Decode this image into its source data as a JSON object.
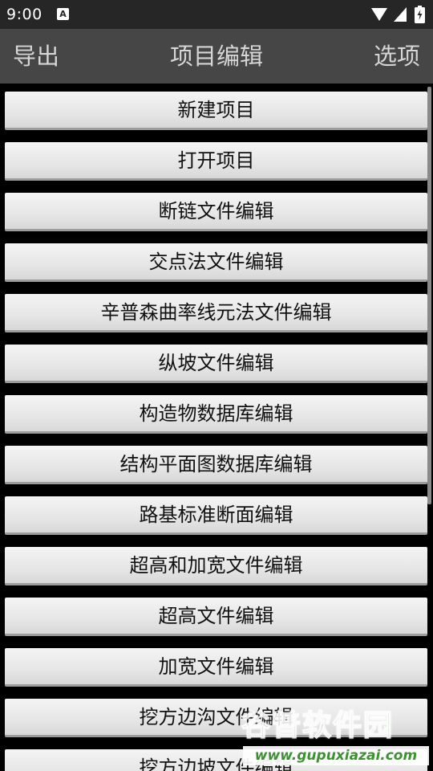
{
  "status_bar": {
    "time": "9:00",
    "badge": "A"
  },
  "app_bar": {
    "export_label": "导出",
    "title": "项目编辑",
    "options_label": "选项"
  },
  "menu": {
    "items": [
      "新建项目",
      "打开项目",
      "断链文件编辑",
      "交点法文件编辑",
      "辛普森曲率线元法文件编辑",
      "纵坡文件编辑",
      "构造物数据库编辑",
      "结构平面图数据库编辑",
      "路基标准断面编辑",
      "超高和加宽文件编辑",
      "超高文件编辑",
      "加宽文件编辑",
      "挖方边沟文件编辑",
      "挖方边坡文件编辑"
    ]
  },
  "watermark": {
    "logo": "谷普软件园",
    "url": "www.gupuxiazai.com"
  },
  "colors": {
    "status_bar": "#262626",
    "app_bar": "#464646",
    "app_bar_text": "#d6d6d6",
    "button_face": "#e6e6e6",
    "background": "#000000",
    "watermark_green": "#3ea82e"
  }
}
